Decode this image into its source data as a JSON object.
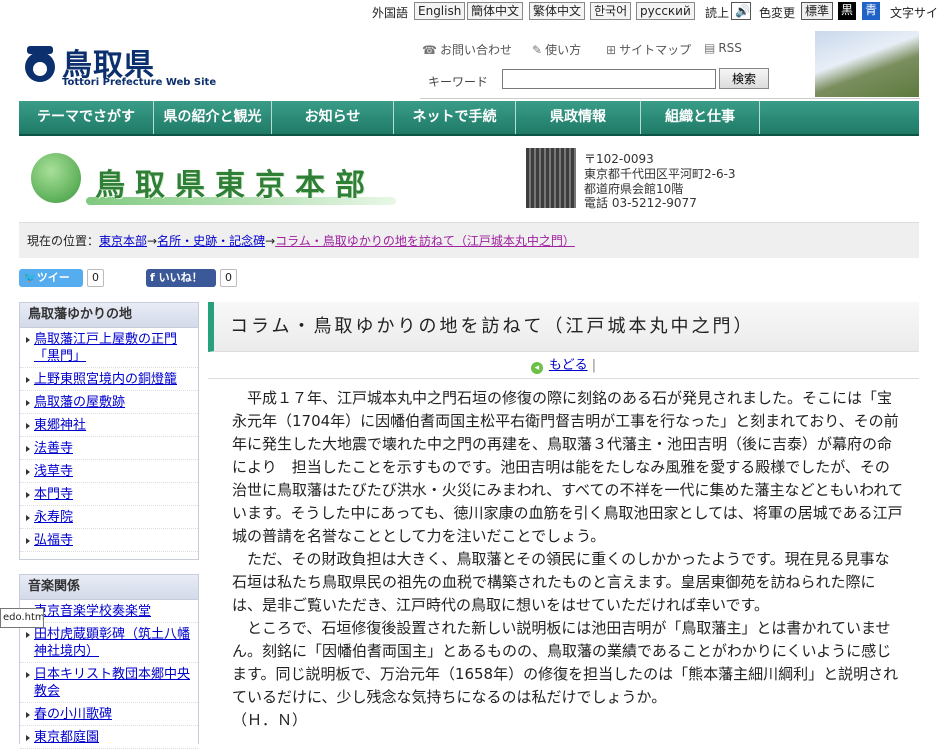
{
  "top_bar": {
    "lang_label": "外国語",
    "languages": [
      "English",
      "簡体中文",
      "繁体中文",
      "한국어",
      "русский"
    ],
    "read_label": "読上",
    "color_label": "色変更",
    "colors": [
      "標準",
      "黒",
      "青"
    ],
    "font_label": "文字サイ",
    "accent_colors": {
      "black": "#000000",
      "blue": "#1e63c5"
    }
  },
  "header": {
    "site_name": "鳥取県",
    "site_sub": "Tottori Prefecture Web Site",
    "utility_links": [
      "お問い合わせ",
      "使い方",
      "サイトマップ",
      "RSS"
    ],
    "search": {
      "label": "キーワード",
      "value": "",
      "button": "検索"
    }
  },
  "nav": {
    "items": [
      "テーマでさがす",
      "県の紹介と観光",
      "お知らせ",
      "ネットで手続",
      "県政情報",
      "組織と仕事"
    ],
    "color": "#26876f"
  },
  "banner": {
    "title": "鳥取県東京本部",
    "address_lines": [
      "〒102-0093",
      "東京都千代田区平河町2-6-3",
      "都道府県会館10階",
      "電話 03-5212-9077"
    ]
  },
  "breadcrumb": {
    "label": "現在の位置：",
    "items": [
      "東京本部",
      "名所・史跡・記念碑",
      "コラム・鳥取ゆかりの地を訪ねて（江戸城本丸中之門）"
    ]
  },
  "social": {
    "tweet_label": "ツイート",
    "tweet_count": "0",
    "like_label": "いいね！",
    "like_count": "0"
  },
  "sidebar": {
    "sections": [
      {
        "title": "鳥取藩ゆかりの地",
        "items": [
          "鳥取藩江戸上屋敷の正門「黒門」",
          "上野東照宮境内の銅燈籠",
          "鳥取藩の屋敷跡",
          "東郷神社",
          "法善寺",
          "浅草寺",
          "本門寺",
          "永寿院",
          "弘福寺"
        ]
      },
      {
        "title": "音楽関係",
        "items": [
          "東京音楽学校奏楽堂",
          "田村虎蔵顕彰碑（筑土八幡神社境内）",
          "日本キリスト教団本郷中央教会",
          "春の小川歌碑",
          "東京都庭園"
        ]
      }
    ]
  },
  "tooltip": {
    "text": "edo.html"
  },
  "main": {
    "title": "コラム・鳥取ゆかりの地を訪ねて（江戸城本丸中之門）",
    "back_label": "もどる",
    "paragraphs": [
      "平成１７年、江戸城本丸中之門石垣の修復の際に刻銘のある石が発見されました。そこには「宝永元年（1704年）に因幡伯耆両国主松平右衛門督吉明が工事を行なった」と刻まれており、その前年に発生した大地震で壊れた中之門の再建を、鳥取藩３代藩主・池田吉明（後に吉泰）が幕府の命により　担当したことを示すものです。池田吉明は能をたしなみ風雅を愛する殿様でしたが、その治世に鳥取藩はたびたび洪水・火災にみまわれ、すべての不祥を一代に集めた藩主などともいわれています。そうした中にあっても、徳川家康の血筋を引く鳥取池田家としては、将軍の居城である江戸城の普請を名誉なこととして力を注いだことでしょう。",
      "ただ、その財政負担は大きく、鳥取藩とその領民に重くのしかかったようです。現在見る見事な石垣は私たち鳥取県民の祖先の血税で構築されたものと言えます。皇居東御苑を訪ねられた際には、是非ご覧いただき、江戸時代の鳥取に想いをはせていただければ幸いです。",
      "ところで、石垣修復後設置された新しい説明板には池田吉明が「鳥取藩主」とは書かれていません。刻銘に「因幡伯耆両国主」とあるものの、鳥取藩の業績であることがわかりにくいように感じます。同じ説明板で、万治元年（1658年）の修復を担当したのは「熊本藩主細川綱利」と説明されているだけに、少し残念な気持ちになるのは私だけでしょうか。",
      "（Ｈ．Ｎ）"
    ]
  }
}
